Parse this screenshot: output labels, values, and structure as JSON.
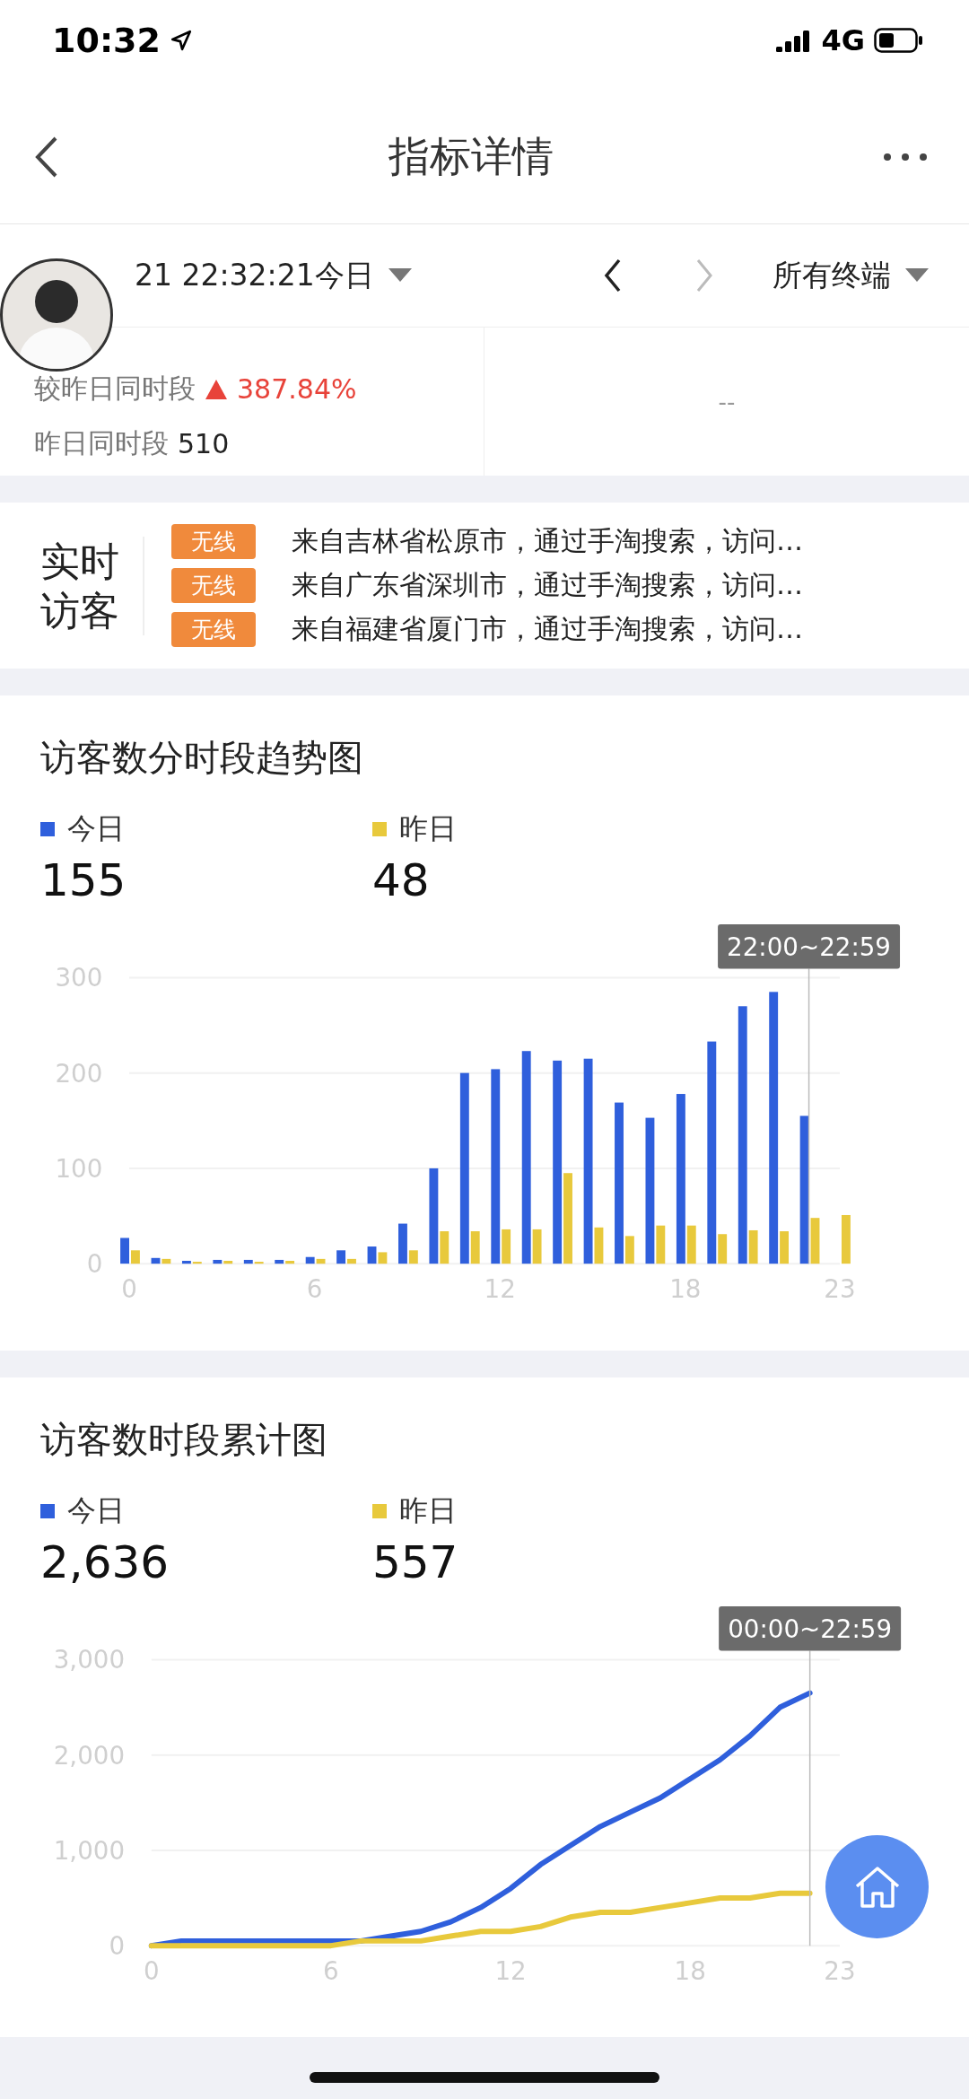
{
  "status_bar": {
    "time": "10:32",
    "network": "4G"
  },
  "nav": {
    "title": "指标详情"
  },
  "filter": {
    "date": "21 22:32:21今日",
    "terminal": "所有终端"
  },
  "comparison": {
    "label": "较昨日同时段",
    "change": "387.84%",
    "yesterday_label": "昨日同时段",
    "yesterday_value": "510",
    "other_value": "--"
  },
  "realtime": {
    "title": "实时访客",
    "rows": [
      {
        "tag": "无线",
        "text": "来自吉林省松原市，通过手淘搜索，访问…"
      },
      {
        "tag": "无线",
        "text": "来自广东省深圳市，通过手淘搜索，访问…"
      },
      {
        "tag": "无线",
        "text": "来自福建省厦门市，通过手淘搜索，访问…"
      }
    ]
  },
  "charts": [
    {
      "title": "访客数分时段趋势图",
      "totals": [
        "155",
        "48"
      ],
      "chart_data": {
        "type": "bar",
        "x": [
          0,
          1,
          2,
          3,
          4,
          5,
          6,
          7,
          8,
          9,
          10,
          11,
          12,
          13,
          14,
          15,
          16,
          17,
          18,
          19,
          20,
          21,
          22,
          23
        ],
        "series": [
          {
            "name": "今日",
            "color": "#2f5fdc",
            "values": [
              27,
              6,
              3,
              4,
              4,
              4,
              7,
              14,
              18,
              42,
              100,
              200,
              204,
              223,
              213,
              215,
              169,
              153,
              178,
              233,
              270,
              285,
              155,
              null
            ]
          },
          {
            "name": "昨日",
            "color": "#e8c93c",
            "values": [
              14,
              5,
              2,
              3,
              2,
              3,
              5,
              5,
              12,
              14,
              34,
              34,
              36,
              36,
              95,
              38,
              29,
              40,
              40,
              31,
              35,
              34,
              48,
              51
            ]
          }
        ],
        "xlim": [
          0,
          23
        ],
        "ylim": [
          0,
          300
        ],
        "yticks": [
          0,
          100,
          200,
          300
        ],
        "xticks": [
          0,
          6,
          12,
          18,
          23
        ],
        "ref_lines": [
          {
            "axis": "x",
            "value": 22
          }
        ],
        "annotations": [
          "22:00~22:59"
        ]
      }
    },
    {
      "title": "访客数时段累计图",
      "totals": [
        "2,636",
        "557"
      ],
      "chart_data": {
        "type": "line",
        "x": [
          0,
          1,
          2,
          3,
          4,
          5,
          6,
          7,
          8,
          9,
          10,
          11,
          12,
          13,
          14,
          15,
          16,
          17,
          18,
          19,
          20,
          21,
          22
        ],
        "series": [
          {
            "name": "今日",
            "color": "#2f5fdc",
            "values": [
              0,
              50,
              50,
              50,
              50,
              50,
              50,
              50,
              100,
              150,
              250,
              400,
              600,
              850,
              1050,
              1250,
              1400,
              1550,
              1750,
              1950,
              2200,
              2500,
              2650
            ]
          },
          {
            "name": "昨日",
            "color": "#e8c93c",
            "values": [
              0,
              0,
              0,
              0,
              0,
              0,
              0,
              50,
              50,
              50,
              100,
              150,
              150,
              200,
              300,
              350,
              350,
              400,
              450,
              500,
              500,
              550,
              550
            ]
          }
        ],
        "xlim": [
          0,
          23
        ],
        "ylim": [
          0,
          3000
        ],
        "yticks": [
          {
            "value": 0,
            "label": "0"
          },
          {
            "value": 1000,
            "label": "1,000"
          },
          {
            "value": 2000,
            "label": "2,000"
          },
          {
            "value": 3000,
            "label": "3,000"
          }
        ],
        "xticks": [
          0,
          6,
          12,
          18,
          23
        ],
        "ref_lines": [
          {
            "axis": "x",
            "value": 22
          }
        ],
        "annotations": [
          "00:00~22:59"
        ]
      }
    }
  ]
}
